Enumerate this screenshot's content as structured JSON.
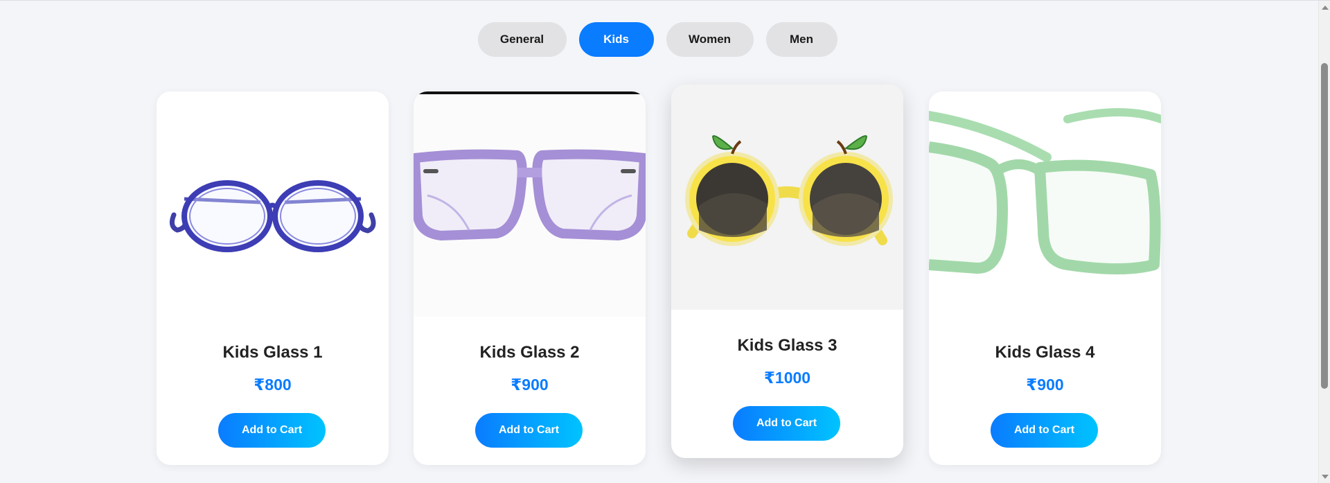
{
  "tabs": [
    {
      "label": "General",
      "active": false
    },
    {
      "label": "Kids",
      "active": true
    },
    {
      "label": "Women",
      "active": false
    },
    {
      "label": "Men",
      "active": false
    }
  ],
  "products": [
    {
      "title": "Kids Glass 1",
      "price": "₹800",
      "button": "Add to Cart",
      "image_icon": "blue-round-kids-glasses"
    },
    {
      "title": "Kids Glass 2",
      "price": "₹900",
      "button": "Add to Cart",
      "image_icon": "purple-square-kids-glasses"
    },
    {
      "title": "Kids Glass 3",
      "price": "₹1000",
      "button": "Add to Cart",
      "image_icon": "yellow-fruit-sunglasses"
    },
    {
      "title": "Kids Glass 4",
      "price": "₹900",
      "button": "Add to Cart",
      "image_icon": "green-square-kids-glasses"
    }
  ],
  "colors": {
    "accent": "#0a7cff",
    "accent_gradient_end": "#00c3ff",
    "tab_inactive": "#e2e2e4",
    "background": "#f4f5f9"
  }
}
